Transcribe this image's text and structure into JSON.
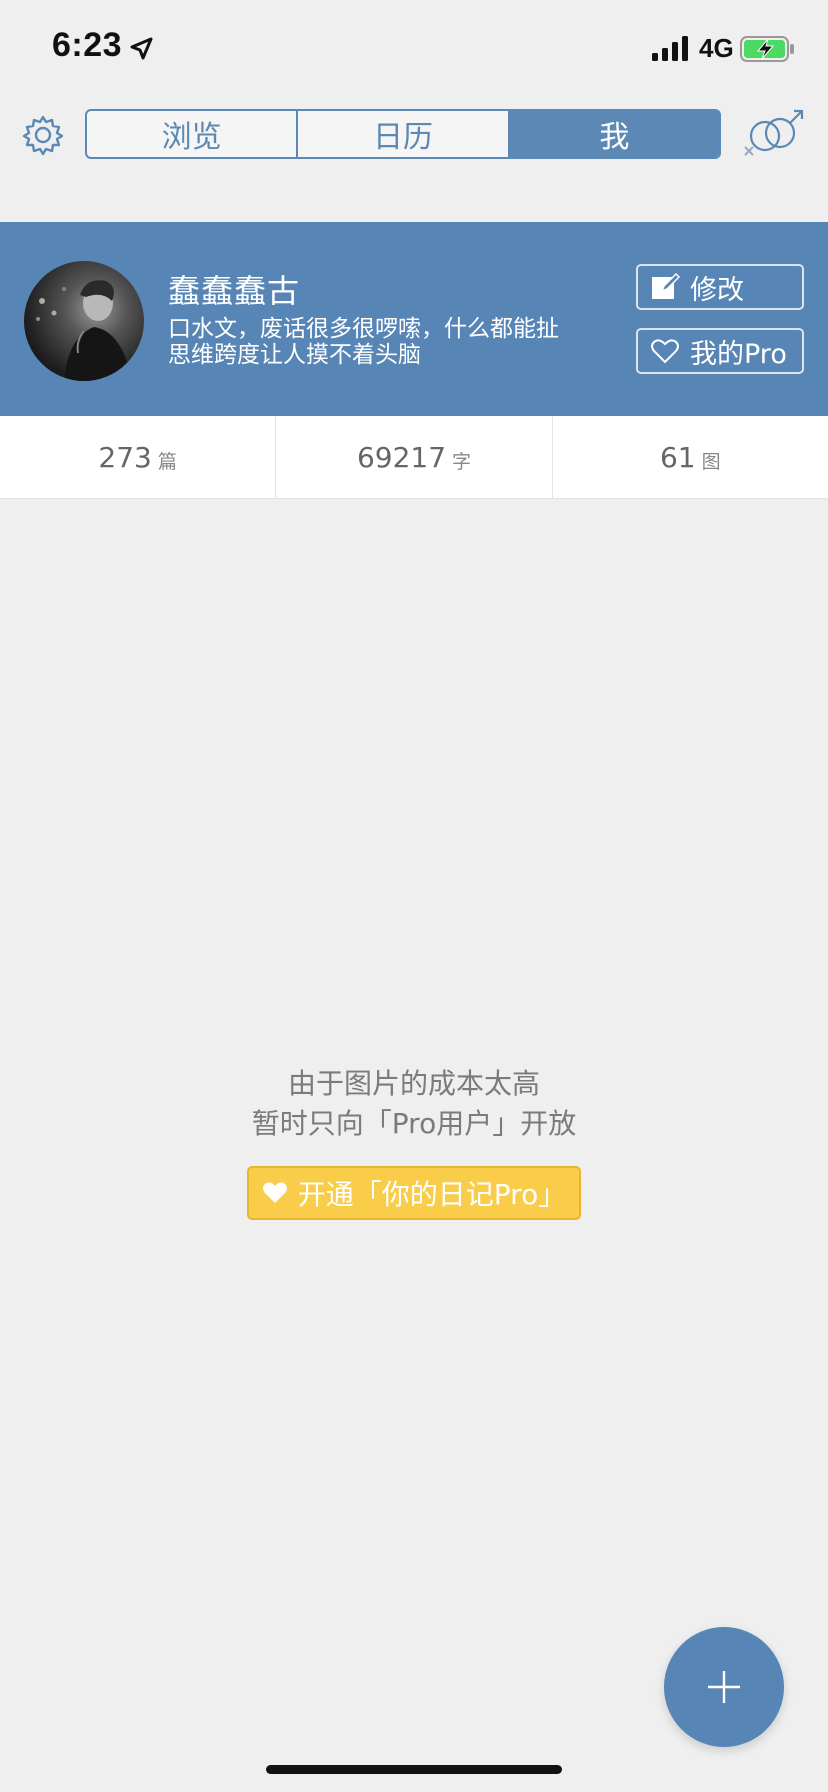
{
  "status_bar": {
    "time": "6:23",
    "network": "4G"
  },
  "nav": {
    "tabs": [
      {
        "label": "浏览",
        "active": false
      },
      {
        "label": "日历",
        "active": false
      },
      {
        "label": "我",
        "active": true
      }
    ],
    "icons": [
      "gear-icon",
      "gender-icon"
    ]
  },
  "profile": {
    "name": "蠢蠢蠢古",
    "bio_line1": "口水文，废话很多很啰嗦，什么都能扯",
    "bio_line2": "思维跨度让人摸不着头脑",
    "edit_label": "修改",
    "pro_label": "我的Pro"
  },
  "stats": [
    {
      "value": "273",
      "unit": "篇"
    },
    {
      "value": "69217",
      "unit": "字"
    },
    {
      "value": "61",
      "unit": "图"
    }
  ],
  "notice": {
    "line1": "由于图片的成本太高",
    "line2": "暂时只向「Pro用户」开放",
    "cta_label": "开通「你的日记Pro」"
  },
  "fab": {
    "icon": "plus-icon"
  },
  "colors": {
    "accent": "#5786b6",
    "background": "#efefef",
    "cta": "#f9cd4a"
  }
}
